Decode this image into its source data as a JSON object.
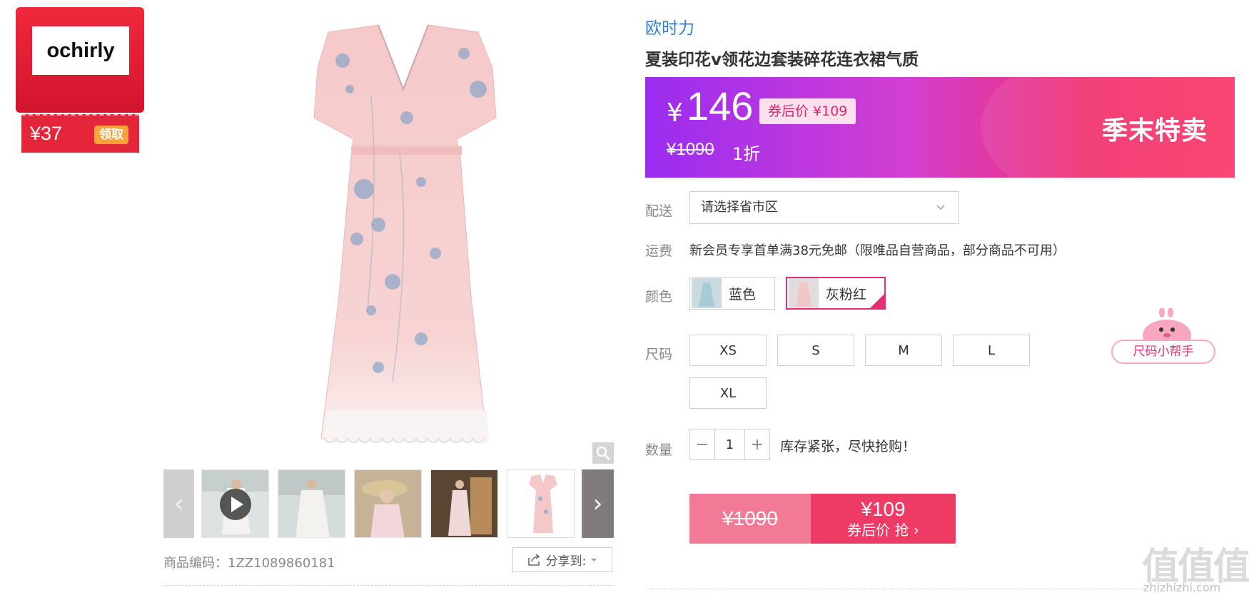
{
  "brand_coupon": {
    "logo_text": "ochirly",
    "amount": "¥37",
    "claim_label": "领取"
  },
  "gallery": {
    "prev_icon": "‹",
    "next_icon": "›",
    "product_code": "商品编码：1ZZ1089860181",
    "share_label": "分享到:",
    "thumbnails": [
      "video-thumb",
      "white-dress-thumb",
      "hat-model-thumb",
      "shop-model-thumb",
      "dress-flat-thumb",
      "pink-dress-thumb"
    ]
  },
  "product": {
    "brand": "欧时力",
    "title": "夏装印花v领花边套装碎花连衣裙气质"
  },
  "price": {
    "currency": "¥",
    "amount": "146",
    "coupon_price": "券后价 ¥109",
    "original": "¥1090",
    "discount": "1折",
    "promo_label": "季末特卖"
  },
  "delivery": {
    "label": "配送",
    "placeholder": "请选择省市区"
  },
  "shipping": {
    "label": "运费",
    "text": "新会员专享首单满38元免邮（限唯品自营商品，部分商品不可用）"
  },
  "colors": {
    "label": "颜色",
    "options": [
      {
        "name": "蓝色",
        "selected": false
      },
      {
        "name": "灰粉红",
        "selected": true
      }
    ]
  },
  "sizes": {
    "label": "尺码",
    "options": [
      "XS",
      "S",
      "M",
      "L",
      "XL"
    ],
    "helper_label": "尺码小帮手"
  },
  "quantity": {
    "label": "数量",
    "minus": "−",
    "value": "1",
    "plus": "+",
    "stock_text": "库存紧张，尽快抢购！"
  },
  "buy": {
    "original": "¥1090",
    "price": "¥109",
    "label": "券后价 抢 ›"
  },
  "watermark": {
    "mark": "值值值",
    "site": "zhizhizhi.com"
  },
  "colors_theme": {
    "accent_pink": "#ee3b66",
    "brand_blue": "#2f7fd3",
    "coupon_red": "#e5253a"
  }
}
